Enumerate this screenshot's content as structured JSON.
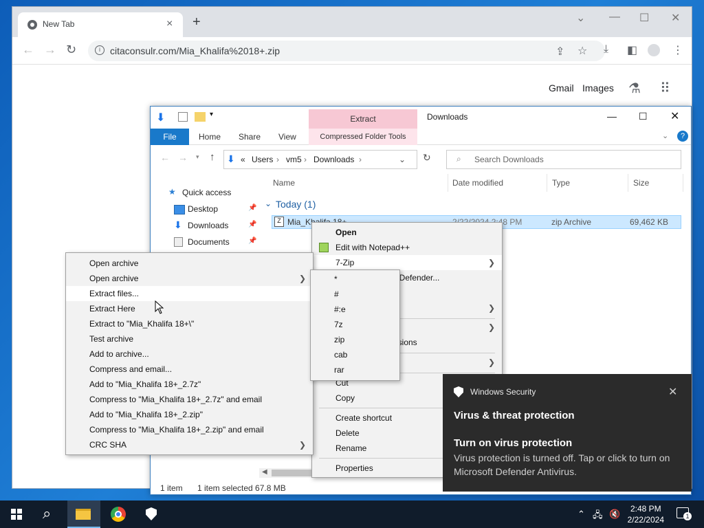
{
  "chrome": {
    "tab_title": "New Tab",
    "url": "citaconsulr.com/Mia_Khalifa%2018+.zip",
    "links": {
      "gmail": "Gmail",
      "images": "Images"
    }
  },
  "explorer": {
    "title": "Downloads",
    "extract_tab": "Extract",
    "ribbon": {
      "file": "File",
      "home": "Home",
      "share": "Share",
      "view": "View",
      "compressed": "Compressed Folder Tools"
    },
    "address": {
      "prefix": "«",
      "parts": [
        "Users",
        "vm5",
        "Downloads"
      ]
    },
    "search_placeholder": "Search Downloads",
    "columns": {
      "name": "Name",
      "date": "Date modified",
      "type": "Type",
      "size": "Size"
    },
    "group": "Today (1)",
    "file": {
      "name": "Mia_Khalifa 18+",
      "date": "2/22/2024 2:48 PM",
      "type": "zip Archive",
      "size": "69,462 KB"
    },
    "nav": {
      "quick_access": "Quick access",
      "desktop": "Desktop",
      "downloads": "Downloads",
      "documents": "Documents"
    },
    "status": {
      "count": "1 item",
      "selected": "1 item selected  67.8 MB"
    }
  },
  "context_menu": {
    "open": "Open",
    "edit_notepad": "Edit with Notepad++",
    "seven_zip": "7-Zip",
    "defender": "oft Defender...",
    "versions": "ersions",
    "cut": "Cut",
    "copy": "Copy",
    "create_shortcut": "Create shortcut",
    "delete": "Delete",
    "rename": "Rename",
    "properties": "Properties"
  },
  "submenu_7zip": [
    {
      "label": "Open archive",
      "arrow": false
    },
    {
      "label": "Open archive",
      "arrow": true
    },
    {
      "label": "Extract files...",
      "arrow": false
    },
    {
      "label": "Extract Here",
      "arrow": false
    },
    {
      "label": "Extract to \"Mia_Khalifa 18+\\\"",
      "arrow": false
    },
    {
      "label": "Test archive",
      "arrow": false
    },
    {
      "label": "Add to archive...",
      "arrow": false
    },
    {
      "label": "Compress and email...",
      "arrow": false
    },
    {
      "label": "Add to \"Mia_Khalifa 18+_2.7z\"",
      "arrow": false
    },
    {
      "label": "Compress to \"Mia_Khalifa 18+_2.7z\" and email",
      "arrow": false
    },
    {
      "label": "Add to \"Mia_Khalifa 18+_2.zip\"",
      "arrow": false
    },
    {
      "label": "Compress to \"Mia_Khalifa 18+_2.zip\" and email",
      "arrow": false
    },
    {
      "label": "CRC SHA",
      "arrow": true
    }
  ],
  "submenu_types": [
    "*",
    "#",
    "#:e",
    "7z",
    "zip",
    "cab",
    "rar"
  ],
  "toast": {
    "app": "Windows Security",
    "title": "Virus & threat protection",
    "subtitle": "Turn on virus protection",
    "body": "Virus protection is turned off. Tap or click to turn on Microsoft Defender Antivirus."
  },
  "taskbar": {
    "time": "2:48 PM",
    "date": "2/22/2024",
    "notif_count": "1"
  }
}
